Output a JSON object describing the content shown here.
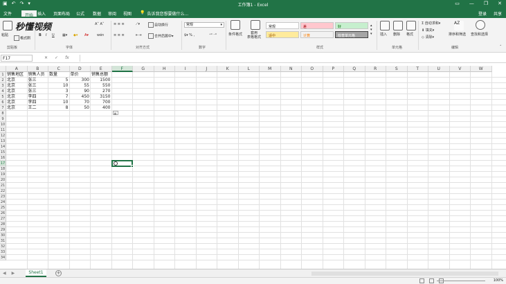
{
  "window": {
    "title": "工作簿1 - Excel"
  },
  "tabs": [
    "文件",
    "开始",
    "插入",
    "页面布局",
    "公式",
    "数据",
    "审阅",
    "视图"
  ],
  "active_tab": "开始",
  "tellme": "告诉我您想要做什么...",
  "header_right": {
    "signin": "登录",
    "share": "共享"
  },
  "watermark": "秒懂视频",
  "ribbon": {
    "groups": [
      "剪贴板",
      "字体",
      "对齐方式",
      "数字",
      "样式",
      "单元格",
      "编辑"
    ],
    "paste": "粘贴",
    "format_painter": "格式刷",
    "wrap_text": "自动换行",
    "merge_center": "合并后居中",
    "number_format": "常规",
    "conditional_format": "条件格式",
    "format_as_table": "套用\n表格格式",
    "styles": {
      "normal": "常规",
      "bad": "差",
      "good": "好",
      "neutral": "适中",
      "calc": "计算",
      "check": "检查单元格"
    },
    "insert": "插入",
    "delete": "删除",
    "format": "格式",
    "autosum": "自动求和",
    "fill": "填充",
    "clear": "清除",
    "sort_filter": "排序和筛选",
    "find_select": "查找和选择"
  },
  "formula_bar": {
    "name_box": "F17",
    "cancel": "✕",
    "enter": "✓",
    "fx": "fx",
    "content": ""
  },
  "columns": [
    "A",
    "B",
    "C",
    "D",
    "E",
    "F",
    "G",
    "H",
    "I",
    "J",
    "K",
    "L",
    "M",
    "N",
    "O",
    "P",
    "Q",
    "R",
    "S",
    "T",
    "U",
    "V",
    "W"
  ],
  "selected_column": "F",
  "selected_row": 17,
  "row_count": 34,
  "table": {
    "headers": [
      "销售地区",
      "销售人员",
      "数量",
      "单价",
      "销售总额"
    ],
    "rows": [
      [
        "北京",
        "张三",
        "5",
        "300",
        "1500"
      ],
      [
        "北京",
        "张三",
        "10",
        "55",
        "550"
      ],
      [
        "北京",
        "张三",
        "3",
        "90",
        "270"
      ],
      [
        "北京",
        "李四",
        "7",
        "450",
        "3150"
      ],
      [
        "北京",
        "李四",
        "10",
        "70",
        "700"
      ],
      [
        "北京",
        "王二",
        "8",
        "50",
        "400"
      ]
    ]
  },
  "sheets": [
    "Sheet1"
  ],
  "status": {
    "zoom": "100%"
  },
  "colors": {
    "accent": "#217346",
    "selected_header_bg": "#d3e5d8"
  }
}
